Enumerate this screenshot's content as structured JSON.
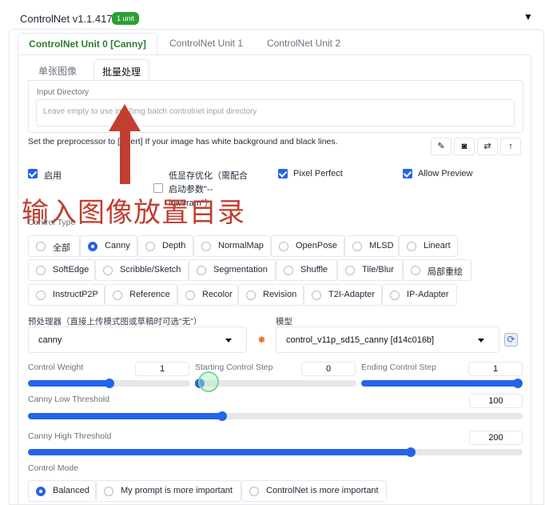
{
  "header": {
    "title": "ControlNet v1.1.417",
    "badge": "1 unit"
  },
  "unit_tabs": [
    "ControlNet Unit 0 [Canny]",
    "ControlNet Unit 1",
    "ControlNet Unit 2"
  ],
  "sub_tabs": [
    "单张图像",
    "批量处理"
  ],
  "input_directory": {
    "label": "Input Directory",
    "placeholder": "Leave empty to use img2img batch controlnet input directory"
  },
  "note": "Set the preprocessor to [invert] If your image has white background and black lines.",
  "tool_icons": [
    "edit-icon",
    "camera-icon",
    "swap-icon",
    "send-up-icon"
  ],
  "checkboxes": {
    "enable": {
      "label": "启用",
      "checked": true
    },
    "lowvram": {
      "label_line1": "低显存优化（需配合",
      "label_line2": "启动参数\"--",
      "label_line3": "lowvram\"）",
      "checked": false
    },
    "pixel_perfect": {
      "label": "Pixel Perfect",
      "checked": true
    },
    "allow_preview": {
      "label": "Allow Preview",
      "checked": true
    }
  },
  "annotation": "输入图像放置目录",
  "control_type": {
    "label": "Control Type",
    "selected": "Canny",
    "row1": [
      "全部",
      "Canny",
      "Depth",
      "NormalMap",
      "OpenPose",
      "MLSD",
      "Lineart"
    ],
    "row2": [
      "SoftEdge",
      "Scribble/Sketch",
      "Segmentation",
      "Shuffle",
      "Tile/Blur",
      "局部重绘"
    ],
    "row3": [
      "InstructP2P",
      "Reference",
      "Recolor",
      "Revision",
      "T2I-Adapter",
      "IP-Adapter"
    ]
  },
  "preprocessor": {
    "label": "预处理器（直接上传模式图或草稿时可选\"无\"）",
    "value": "canny"
  },
  "model": {
    "label": "模型",
    "value": "control_v11p_sd15_canny [d14c016b]"
  },
  "sliders": {
    "control_weight": {
      "label": "Control Weight",
      "value": "1",
      "fraction": 0.5
    },
    "starting_step": {
      "label": "Starting Control Step",
      "value": "0",
      "fraction": 0.0
    },
    "ending_step": {
      "label": "Ending Control Step",
      "value": "1",
      "fraction": 1.0
    },
    "canny_low": {
      "label": "Canny Low Threshold",
      "value": "100",
      "fraction": 0.39
    },
    "canny_high": {
      "label": "Canny High Threshold",
      "value": "200",
      "fraction": 0.78
    }
  },
  "control_mode": {
    "label": "Control Mode",
    "options": [
      "Balanced",
      "My prompt is more important",
      "ControlNet is more important"
    ],
    "selected": "Balanced"
  },
  "colors": {
    "accent": "#2563eb",
    "annotation": "#c13e30",
    "badge": "#2e9e35"
  }
}
